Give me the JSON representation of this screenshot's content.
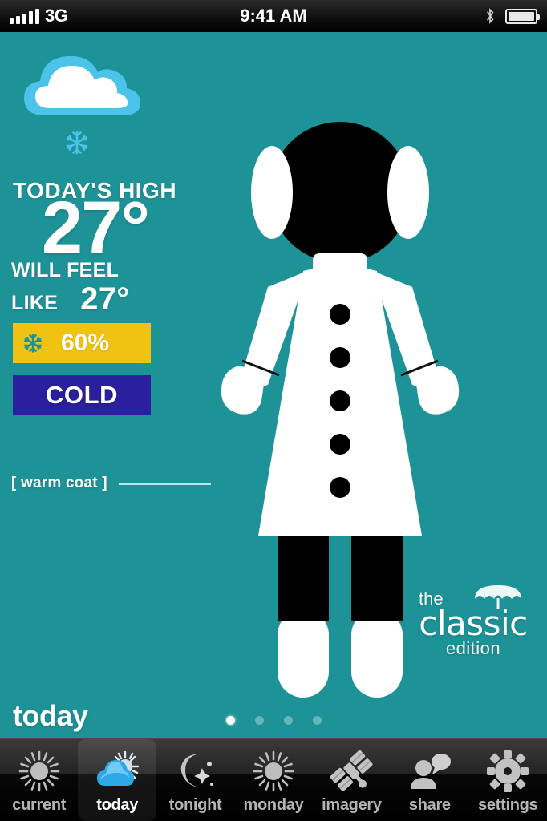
{
  "status_bar": {
    "signal_icon": "signal-bars-icon",
    "carrier": "3G",
    "time": "9:41 AM",
    "bluetooth_icon": "bluetooth-icon",
    "battery_icon": "battery-icon"
  },
  "weather": {
    "condition_icon": "cloud-snow-icon",
    "snow_icon": "snowflake-icon",
    "high_label": "TODAY'S HIGH",
    "high_value": "27°",
    "feels_label_line1": "WILL FEEL",
    "feels_label_line2": "LIKE",
    "feels_value": "27°",
    "precip_icon": "snowflake-icon",
    "precip_value": "60%",
    "cold_label": "COLD",
    "callout_label": "[ warm coat ]"
  },
  "figure": {
    "name": "dressed-person-illustration",
    "earmuffs": "earmuffs-icon",
    "coat": "warm-coat",
    "buttons_count": 5,
    "mittens": "mittens",
    "boots": "boots"
  },
  "logo": {
    "umbrella_icon": "umbrella-icon",
    "line1": "the",
    "line2": "classic",
    "line3": "edition"
  },
  "footer": {
    "page_label": "today",
    "dots_total": 4,
    "dots_active_index": 0
  },
  "tabbar": {
    "items": [
      {
        "label": "current",
        "icon": "sun-icon",
        "active": false
      },
      {
        "label": "today",
        "icon": "cloud-sun-icon",
        "active": true
      },
      {
        "label": "tonight",
        "icon": "moon-stars-icon",
        "active": false
      },
      {
        "label": "monday",
        "icon": "sun-icon",
        "active": false
      },
      {
        "label": "imagery",
        "icon": "satellite-icon",
        "active": false
      },
      {
        "label": "share",
        "icon": "person-speech-icon",
        "active": false
      },
      {
        "label": "settings",
        "icon": "gear-icon",
        "active": false
      }
    ]
  },
  "colors": {
    "background_teal": "#1d9398",
    "precip_yellow": "#f0c211",
    "cold_blue": "#2a1f9c",
    "cloud_blue": "#4cc3e8",
    "accent_white": "#ffffff",
    "tab_active_blue": "#2fa8e8"
  }
}
